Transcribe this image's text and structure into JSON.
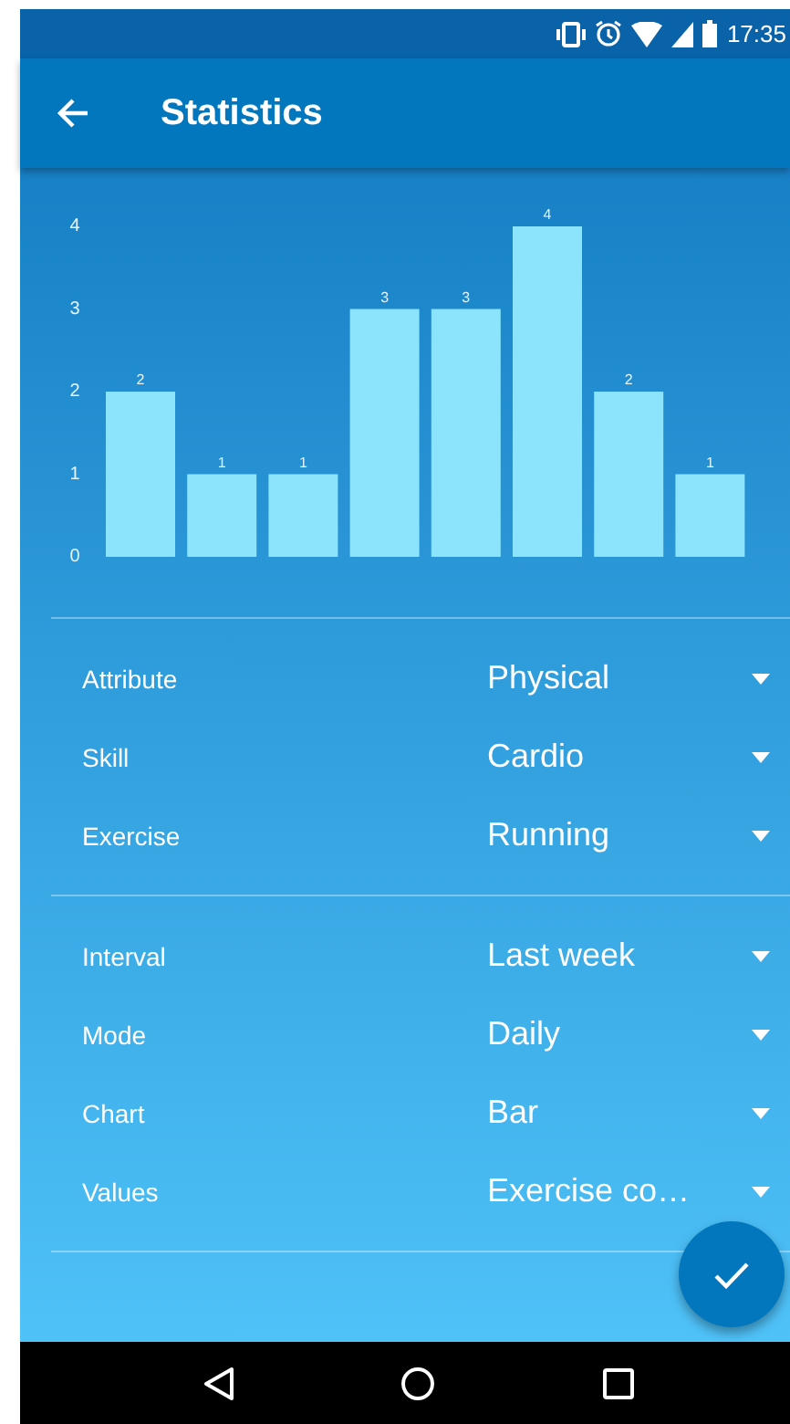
{
  "status_bar": {
    "time": "17:35"
  },
  "app_bar": {
    "title": "Statistics"
  },
  "chart": {
    "chart_data": {
      "type": "bar",
      "categories": [
        null,
        null,
        null,
        null,
        null,
        null,
        null,
        null
      ],
      "ylim": [
        0,
        4
      ],
      "yticks": [
        0,
        1,
        2,
        3,
        4
      ],
      "data_labels": true,
      "series": [
        {
          "color": "#8be4fb",
          "values": [
            2,
            1,
            1,
            3,
            3,
            4,
            2,
            1
          ]
        }
      ]
    }
  },
  "sections": [
    {
      "rows": [
        {
          "label": "Attribute",
          "value": "Physical"
        },
        {
          "label": "Skill",
          "value": "Cardio"
        },
        {
          "label": "Exercise",
          "value": "Running"
        }
      ]
    },
    {
      "rows": [
        {
          "label": "Interval",
          "value": "Last week"
        },
        {
          "label": "Mode",
          "value": "Daily"
        },
        {
          "label": "Chart",
          "value": "Bar"
        },
        {
          "label": "Values",
          "value": "Exercise co…"
        }
      ]
    }
  ]
}
